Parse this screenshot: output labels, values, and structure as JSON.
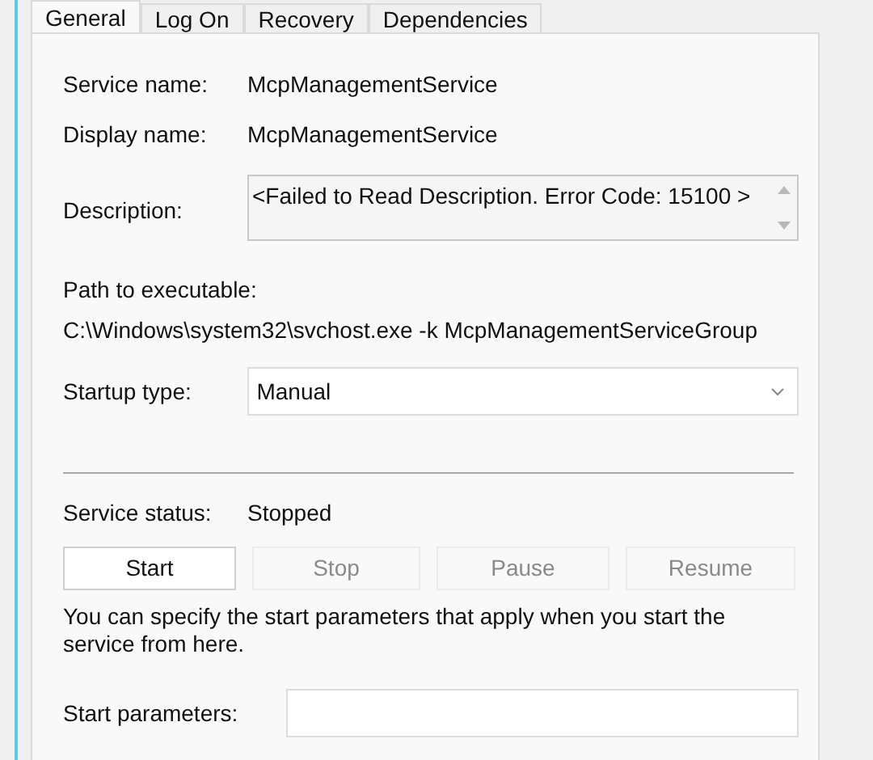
{
  "tabs": [
    {
      "label": "General",
      "selected": true
    },
    {
      "label": "Log On",
      "selected": false
    },
    {
      "label": "Recovery",
      "selected": false
    },
    {
      "label": "Dependencies",
      "selected": false
    }
  ],
  "service_name": {
    "label": "Service name:",
    "value": "McpManagementService"
  },
  "display_name": {
    "label": "Display name:",
    "value": "McpManagementService"
  },
  "description": {
    "label": "Description:",
    "value": "<Failed to Read Description. Error Code: 15100 >"
  },
  "path": {
    "label": "Path to executable:",
    "value": "C:\\Windows\\system32\\svchost.exe -k McpManagementServiceGroup"
  },
  "startup_type": {
    "label": "Startup type:",
    "value": "Manual"
  },
  "service_status": {
    "label": "Service status:",
    "value": "Stopped"
  },
  "buttons": [
    {
      "label": "Start",
      "disabled": false
    },
    {
      "label": "Stop",
      "disabled": true
    },
    {
      "label": "Pause",
      "disabled": true
    },
    {
      "label": "Resume",
      "disabled": true
    }
  ],
  "hint": "You can specify the start parameters that apply when you start the service from here.",
  "start_parameters": {
    "label": "Start parameters:"
  }
}
